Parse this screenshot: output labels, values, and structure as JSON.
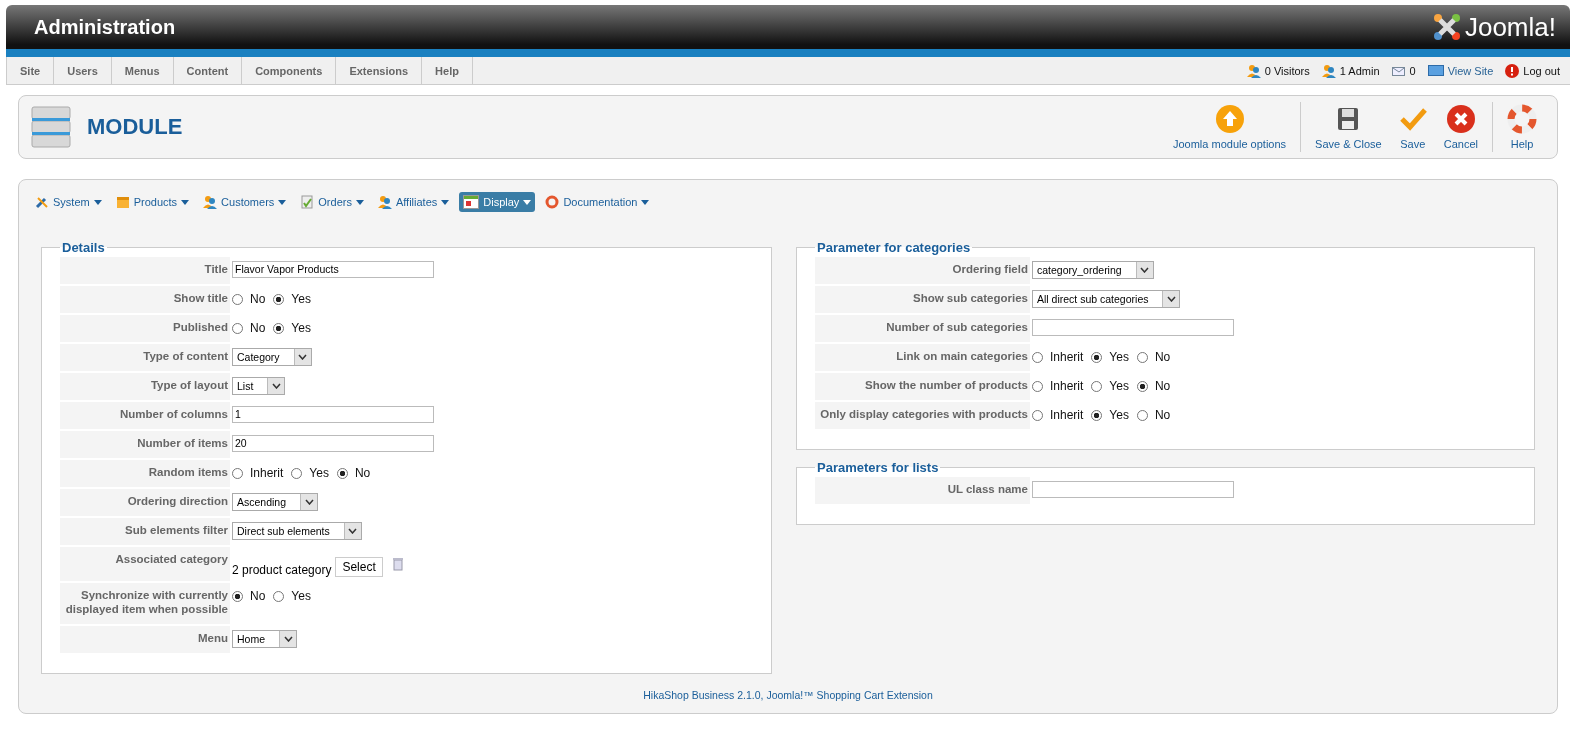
{
  "header": {
    "title": "Administration",
    "logo": "Joomla!"
  },
  "menu": [
    "Site",
    "Users",
    "Menus",
    "Content",
    "Components",
    "Extensions",
    "Help"
  ],
  "status": [
    {
      "kind": "visitors",
      "label": "0 Visitors"
    },
    {
      "kind": "admin",
      "label": "1 Admin"
    },
    {
      "kind": "messages",
      "label": "0"
    },
    {
      "kind": "view",
      "label": "View Site"
    },
    {
      "kind": "logout",
      "label": "Log out"
    }
  ],
  "toolbar": {
    "title": "MODULE",
    "buttons": [
      {
        "kind": "options",
        "label": "Joomla module options"
      },
      {
        "kind": "saveclose",
        "label": "Save & Close"
      },
      {
        "kind": "save",
        "label": "Save"
      },
      {
        "kind": "cancel",
        "label": "Cancel"
      },
      {
        "kind": "help",
        "label": "Help"
      }
    ]
  },
  "nav": [
    {
      "kind": "system",
      "label": "System",
      "selected": false
    },
    {
      "kind": "products",
      "label": "Products",
      "selected": false
    },
    {
      "kind": "customers",
      "label": "Customers",
      "selected": false
    },
    {
      "kind": "orders",
      "label": "Orders",
      "selected": false
    },
    {
      "kind": "affiliates",
      "label": "Affiliates",
      "selected": false
    },
    {
      "kind": "display",
      "label": "Display",
      "selected": true
    },
    {
      "kind": "documentation",
      "label": "Documentation",
      "selected": false
    }
  ],
  "columns": [
    [
      {
        "legend": "Details",
        "fields": [
          {
            "kind": "text",
            "label": "Title",
            "value": "Flavor Vapor Products"
          },
          {
            "kind": "radio",
            "label": "Show title",
            "options": [
              {
                "label": "No",
                "selected": false
              },
              {
                "label": "Yes",
                "selected": true
              }
            ]
          },
          {
            "kind": "radio",
            "label": "Published",
            "options": [
              {
                "label": "No",
                "selected": false
              },
              {
                "label": "Yes",
                "selected": true
              }
            ]
          },
          {
            "kind": "select",
            "label": "Type of content",
            "value": "Category"
          },
          {
            "kind": "select",
            "label": "Type of layout",
            "value": "List"
          },
          {
            "kind": "text",
            "label": "Number of columns",
            "value": "1"
          },
          {
            "kind": "text",
            "label": "Number of items",
            "value": "20"
          },
          {
            "kind": "radio",
            "label": "Random items",
            "options": [
              {
                "label": "Inherit",
                "selected": false
              },
              {
                "label": "Yes",
                "selected": false
              },
              {
                "label": "No",
                "selected": true
              }
            ]
          },
          {
            "kind": "select",
            "label": "Ordering direction",
            "value": "Ascending"
          },
          {
            "kind": "select",
            "label": "Sub elements filter",
            "value": "Direct sub elements"
          },
          {
            "kind": "category",
            "label": "Associated category",
            "value": "2 product category",
            "button": "Select"
          },
          {
            "kind": "radio",
            "label": "Synchronize with currently displayed item when possible",
            "options": [
              {
                "label": "No",
                "selected": true
              },
              {
                "label": "Yes",
                "selected": false
              }
            ]
          },
          {
            "kind": "select",
            "label": "Menu",
            "value": "Home"
          }
        ]
      }
    ],
    [
      {
        "legend": "Parameter for categories",
        "fields": [
          {
            "kind": "select",
            "label": "Ordering field",
            "value": "category_ordering"
          },
          {
            "kind": "select",
            "label": "Show sub categories",
            "value": "All direct sub categories"
          },
          {
            "kind": "text",
            "label": "Number of sub categories"
          },
          {
            "kind": "radio",
            "label": "Link on main categories",
            "options": [
              {
                "label": "Inherit",
                "selected": false
              },
              {
                "label": "Yes",
                "selected": true
              },
              {
                "label": "No",
                "selected": false
              }
            ]
          },
          {
            "kind": "radio",
            "label": "Show the number of products",
            "options": [
              {
                "label": "Inherit",
                "selected": false
              },
              {
                "label": "Yes",
                "selected": false
              },
              {
                "label": "No",
                "selected": true
              }
            ]
          },
          {
            "kind": "radio",
            "label": "Only display categories with products",
            "options": [
              {
                "label": "Inherit",
                "selected": false
              },
              {
                "label": "Yes",
                "selected": true
              },
              {
                "label": "No",
                "selected": false
              }
            ]
          }
        ]
      },
      {
        "legend": "Parameters for lists",
        "fields": [
          {
            "kind": "text",
            "label": "UL class name"
          }
        ]
      }
    ]
  ],
  "footer": "HikaShop Business 2.1.0, Joomla!™ Shopping Cart Extension"
}
